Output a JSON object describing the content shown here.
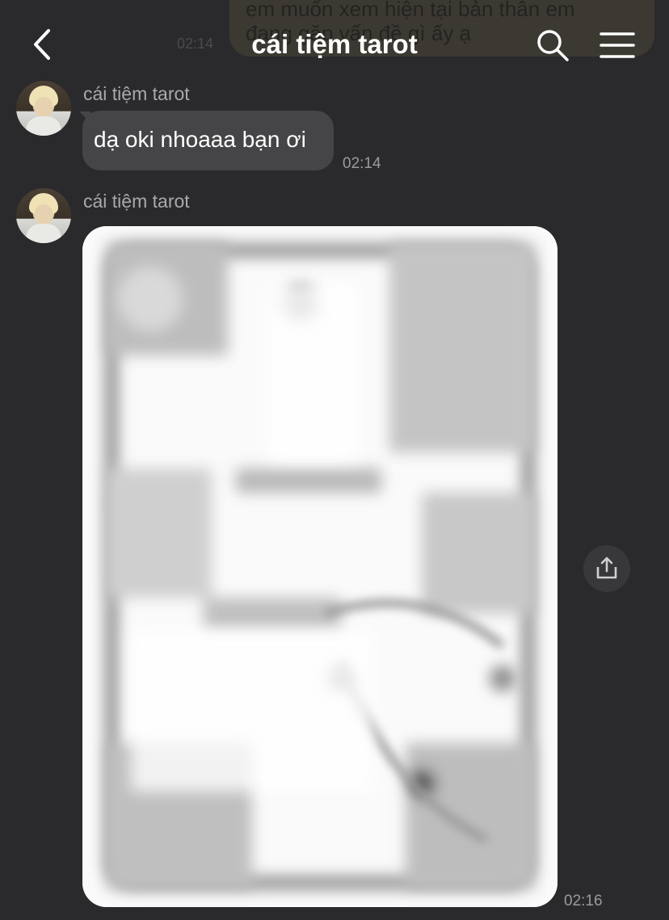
{
  "header": {
    "title": "cái tiệm tarot",
    "icons": {
      "back": "chevron-left-icon",
      "search": "search-icon",
      "menu": "hamburger-menu-icon"
    }
  },
  "outgoing_partial": {
    "lines": [
      "em muốn xem hiện tại bản thân em",
      "đang gặp vấn đề gì ấy ạ"
    ],
    "time": "02:14"
  },
  "messages": [
    {
      "sender": "cái tiệm tarot",
      "text": "dạ oki nhoaaa bạn ơi",
      "time": "02:14"
    },
    {
      "sender": "cái tiệm tarot",
      "type": "image",
      "time": "02:16",
      "share_icon": "share-icon"
    }
  ],
  "colors": {
    "background": "#2a2a2d",
    "incoming_bubble": "#454548",
    "outgoing_bubble": "#4a4636",
    "sender_name": "#a9a9ad",
    "timestamp": "#9a9a9e"
  }
}
